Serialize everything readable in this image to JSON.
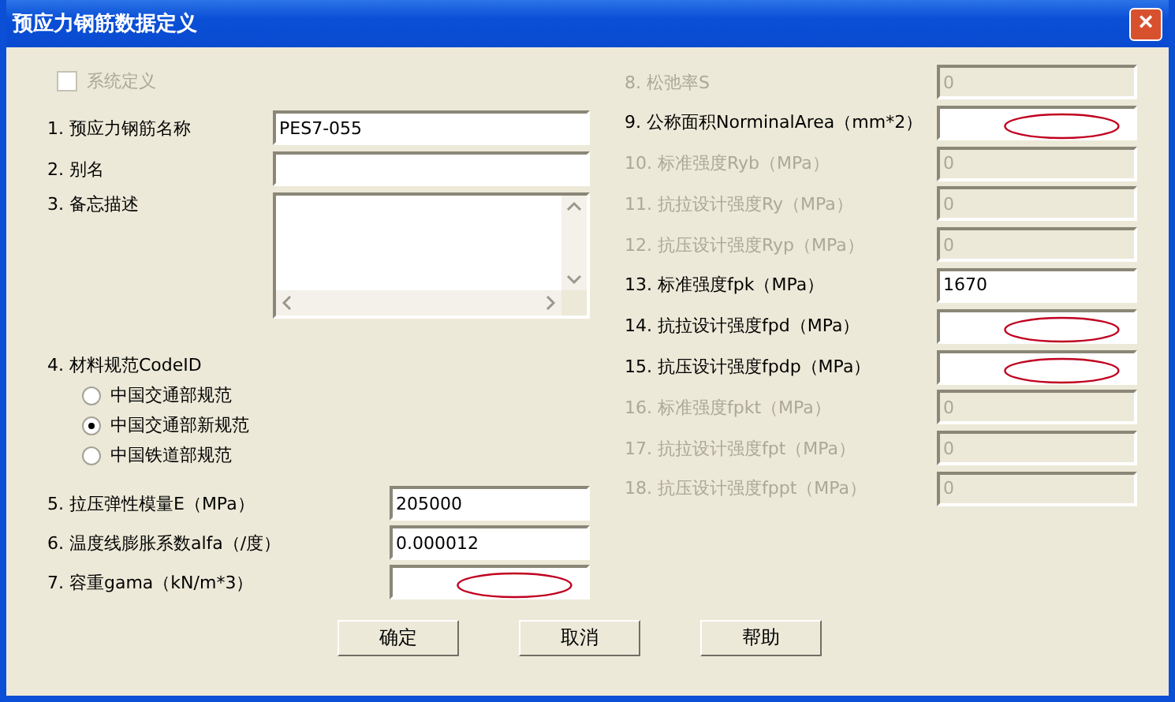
{
  "window": {
    "title": "预应力钢筋数据定义",
    "close": "×"
  },
  "system_defined": {
    "label": "系统定义",
    "checked": false,
    "disabled": true
  },
  "left_fields": [
    {
      "label": "1. 预应力钢筋名称",
      "value": "PES7-055",
      "kind": "text",
      "circled": false
    },
    {
      "label": "2. 别名",
      "kind": "text",
      "circled": false
    },
    {
      "label": "3. 备忘描述",
      "kind": "memo"
    }
  ],
  "code": {
    "label": "4. 材料规范CodeID",
    "options": [
      {
        "label": "中国交通部规范",
        "selected": false
      },
      {
        "label": "中国交通部新规范",
        "selected": true
      },
      {
        "label": "中国铁道部规范",
        "selected": false
      }
    ]
  },
  "left_fields2": [
    {
      "label": "5. 拉压弹性模量E（MPa）",
      "value": "205000",
      "circled": false
    },
    {
      "label": "6. 温度线膨胀系数alfa（/度）",
      "value": "0.000012",
      "circled": false
    },
    {
      "label": "7. 容重gama（kN/m*3）",
      "circled": true
    }
  ],
  "right_fields": [
    {
      "label": "8. 松弛率S",
      "value": "0",
      "disabled": true,
      "circled": false
    },
    {
      "label": "9. 公称面积NorminalArea（mm*2）",
      "disabled": false,
      "circled": true
    },
    {
      "label": "10. 标准强度Ryb（MPa）",
      "value": "0",
      "disabled": true,
      "circled": false
    },
    {
      "label": "11. 抗拉设计强度Ry（MPa）",
      "value": "0",
      "disabled": true,
      "circled": false
    },
    {
      "label": "12. 抗压设计强度Ryp（MPa）",
      "value": "0",
      "disabled": true,
      "circled": false
    },
    {
      "label": "13. 标准强度fpk（MPa）",
      "value": "1670",
      "disabled": false,
      "circled": false
    },
    {
      "label": "14. 抗拉设计强度fpd（MPa）",
      "disabled": false,
      "circled": true
    },
    {
      "label": "15. 抗压设计强度fpdp（MPa）",
      "disabled": false,
      "circled": true
    },
    {
      "label": "16. 标准强度fpkt（MPa）",
      "value": "0",
      "disabled": true,
      "circled": false
    },
    {
      "label": "17. 抗拉设计强度fpt（MPa）",
      "value": "0",
      "disabled": true,
      "circled": false
    },
    {
      "label": "18. 抗压设计强度fppt（MPa）",
      "value": "0",
      "disabled": true,
      "circled": false
    }
  ],
  "buttons": [
    "确定",
    "取消",
    "帮助"
  ]
}
